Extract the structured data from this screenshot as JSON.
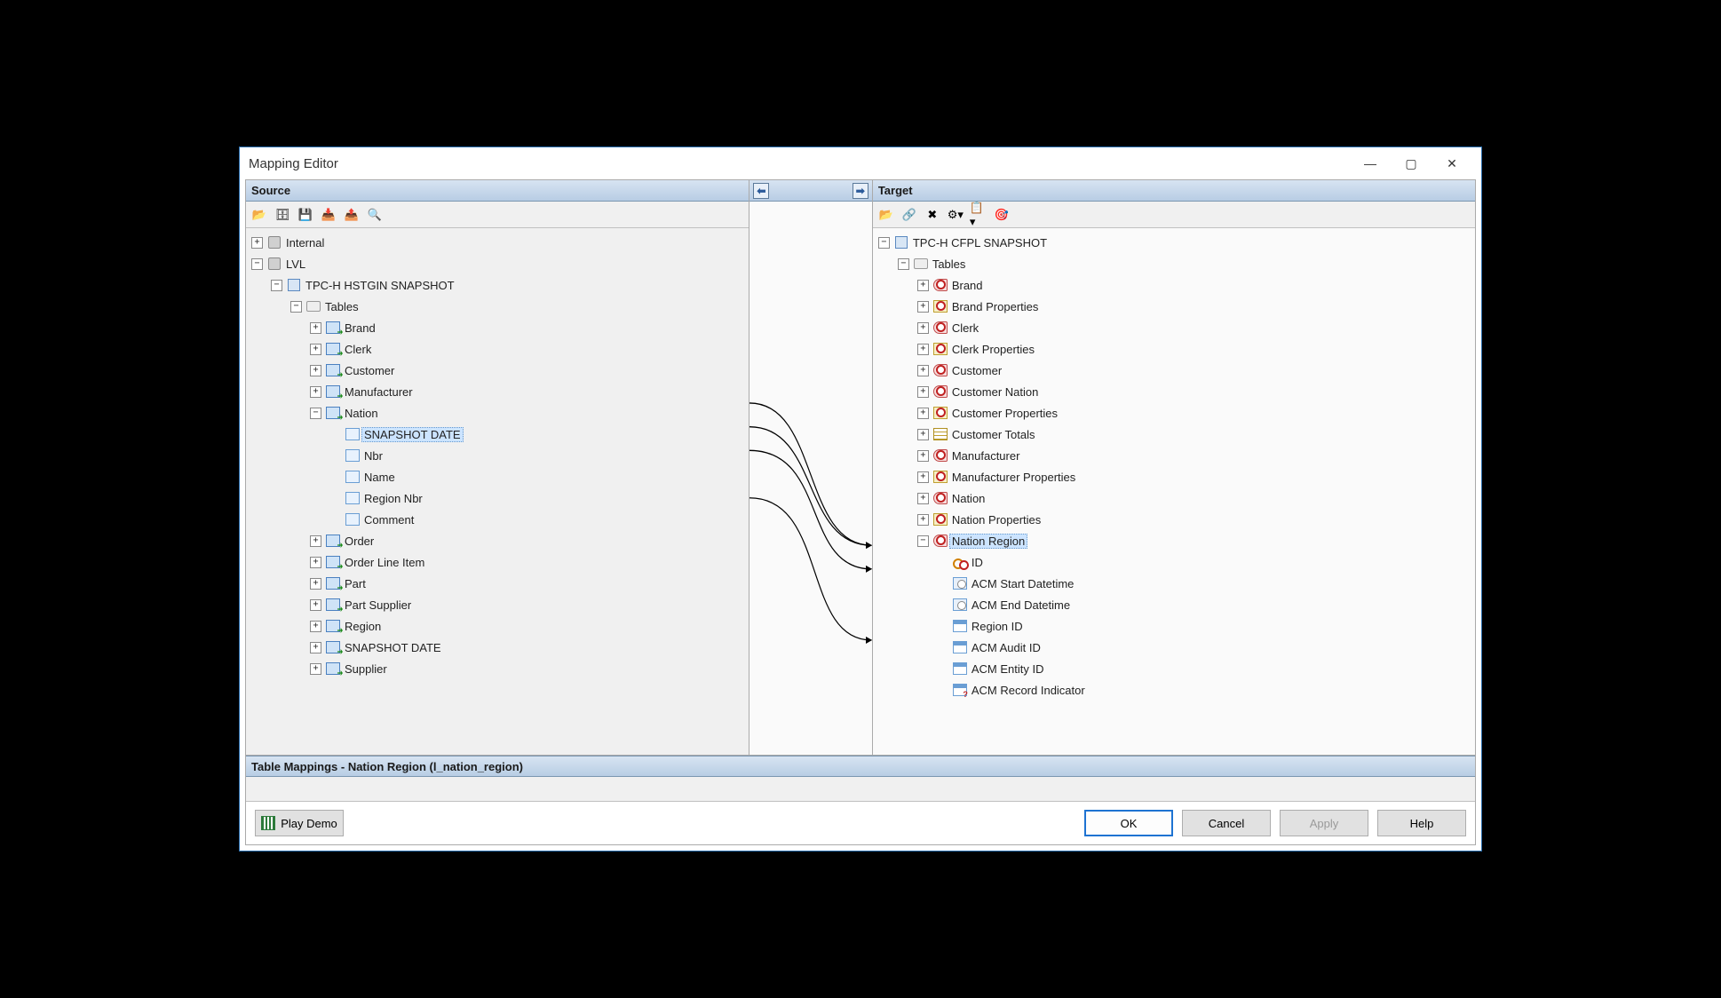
{
  "window": {
    "title": "Mapping Editor"
  },
  "panels": {
    "source": "Source",
    "target": "Target"
  },
  "source_tree": {
    "internal": "Internal",
    "lvl": "LVL",
    "snapshot": "TPC-H HSTGIN SNAPSHOT",
    "tables_label": "Tables",
    "tables": [
      "Brand",
      "Clerk",
      "Customer",
      "Manufacturer"
    ],
    "nation": {
      "label": "Nation",
      "cols": [
        "SNAPSHOT DATE",
        "Nbr",
        "Name",
        "Region Nbr",
        "Comment"
      ]
    },
    "tables_after": [
      "Order",
      "Order Line Item",
      "Part",
      "Part Supplier",
      "Region",
      "SNAPSHOT DATE",
      "Supplier"
    ]
  },
  "target_tree": {
    "snapshot": "TPC-H CFPL SNAPSHOT",
    "tables_label": "Tables",
    "items": [
      {
        "label": "Brand",
        "icon": "red"
      },
      {
        "label": "Brand Properties",
        "icon": "yellow"
      },
      {
        "label": "Clerk",
        "icon": "red"
      },
      {
        "label": "Clerk Properties",
        "icon": "yellow"
      },
      {
        "label": "Customer",
        "icon": "red"
      },
      {
        "label": "Customer Nation",
        "icon": "red"
      },
      {
        "label": "Customer Properties",
        "icon": "yellow"
      },
      {
        "label": "Customer Totals",
        "icon": "grid"
      },
      {
        "label": "Manufacturer",
        "icon": "red"
      },
      {
        "label": "Manufacturer Properties",
        "icon": "yellow"
      },
      {
        "label": "Nation",
        "icon": "red"
      },
      {
        "label": "Nation Properties",
        "icon": "yellow"
      }
    ],
    "nation_region": {
      "label": "Nation Region",
      "cols": [
        {
          "label": "ID",
          "icon": "key"
        },
        {
          "label": "ACM Start Datetime",
          "icon": "clock"
        },
        {
          "label": "ACM End Datetime",
          "icon": "clock"
        },
        {
          "label": "Region ID",
          "icon": "small-tbl"
        },
        {
          "label": "ACM Audit ID",
          "icon": "small-tbl"
        },
        {
          "label": "ACM Entity ID",
          "icon": "small-tbl"
        },
        {
          "label": "ACM Record Indicator",
          "icon": "small-tbl-q"
        }
      ]
    }
  },
  "table_mappings": {
    "header": "Table Mappings - Nation Region (l_nation_region)"
  },
  "footer": {
    "play_demo": "Play Demo",
    "ok": "OK",
    "cancel": "Cancel",
    "apply": "Apply",
    "help": "Help"
  }
}
